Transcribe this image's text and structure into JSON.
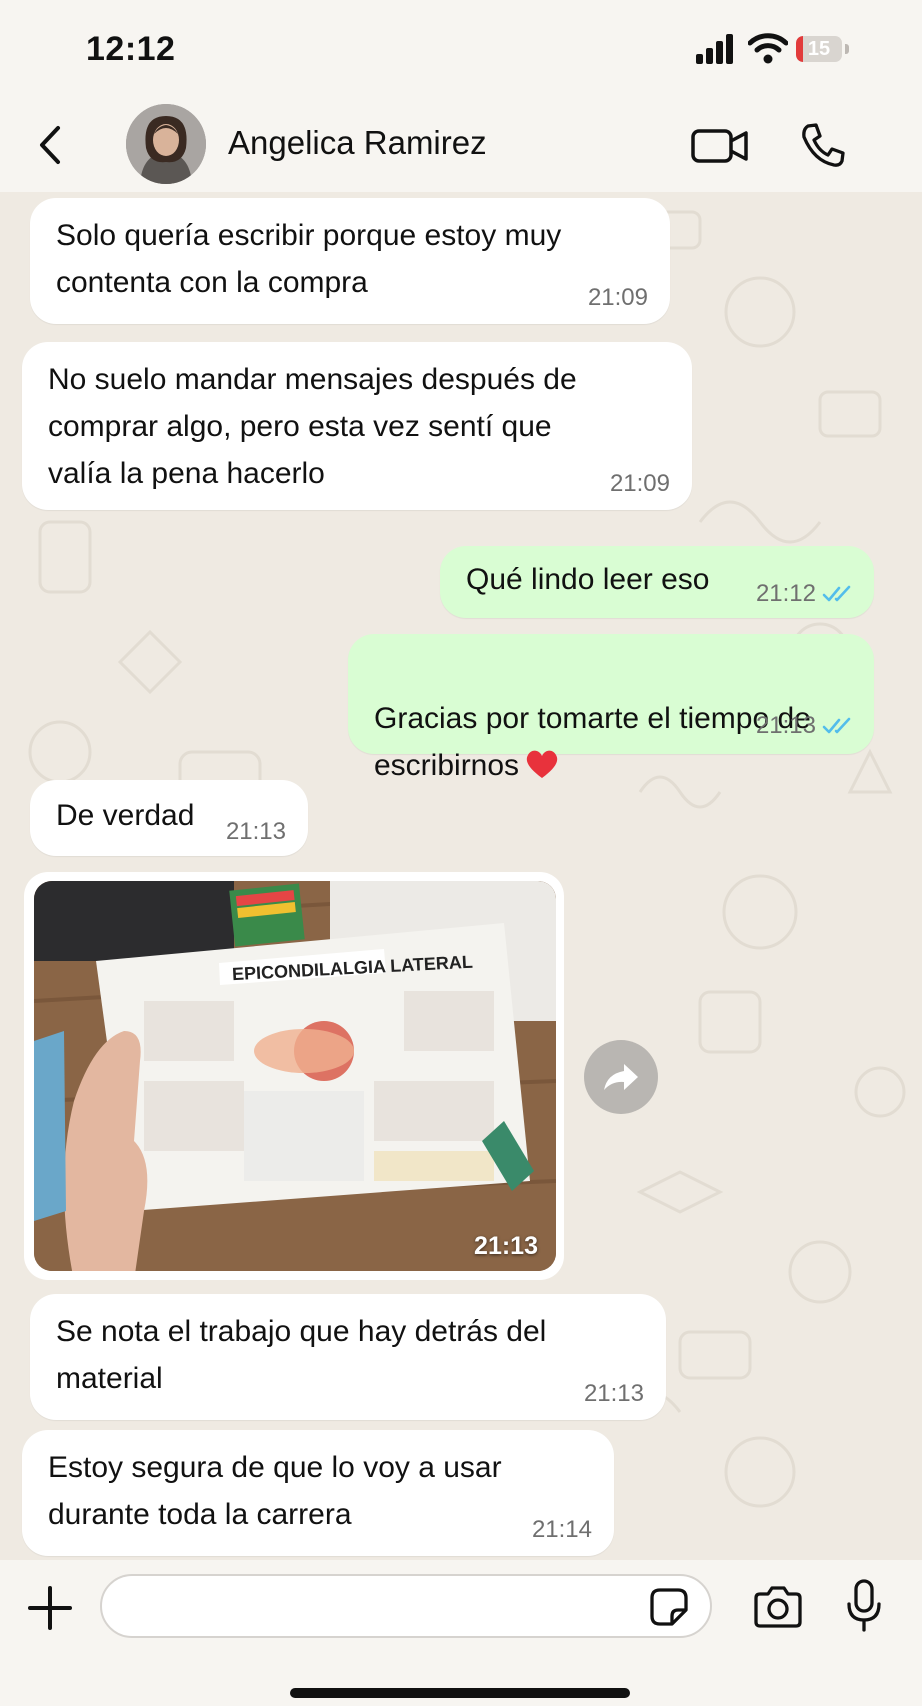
{
  "status_bar": {
    "time": "12:12",
    "battery_level": "15",
    "battery_fraction": 0.15
  },
  "header": {
    "contact_name": "Angelica Ramirez"
  },
  "messages": [
    {
      "direction": "in",
      "text": "Solo quería escribir porque estoy muy\ncontenta con la compra",
      "time": "21:09"
    },
    {
      "direction": "in",
      "text": "No suelo mandar mensajes después de\ncomprar algo, pero esta vez sentí que\nvalía la pena hacerlo",
      "time": "21:09"
    },
    {
      "direction": "out",
      "text": "Qué lindo leer eso",
      "time": "21:12",
      "status": "read"
    },
    {
      "direction": "out",
      "text": "Gracias por tomarte el tiempo de\nescribirnos",
      "emoji": "red-heart",
      "time": "21:13",
      "status": "read"
    },
    {
      "direction": "in",
      "text": "De verdad",
      "time": "21:13"
    },
    {
      "direction": "in",
      "type": "image",
      "image_title": "EPICONDILALGIA LATERAL",
      "time": "21:13"
    },
    {
      "direction": "in",
      "text": "Se nota el trabajo que hay detrás del\nmaterial",
      "time": "21:13"
    },
    {
      "direction": "in",
      "text": "Estoy segura de que lo voy a usar\ndurante toda la carrera",
      "time": "21:14"
    }
  ],
  "input": {
    "placeholder": ""
  },
  "colors": {
    "incoming_bubble": "#ffffff",
    "outgoing_bubble": "#d9fdd3",
    "read_ticks": "#53bdeb",
    "background": "#efeae2"
  },
  "icons": [
    "back-icon",
    "video-call-icon",
    "voice-call-icon",
    "forward-icon",
    "plus-icon",
    "sticker-icon",
    "camera-icon",
    "microphone-icon"
  ]
}
